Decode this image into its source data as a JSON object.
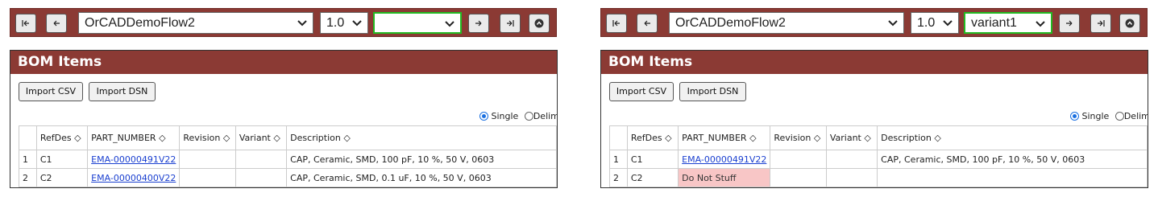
{
  "panels": [
    {
      "toolbar": {
        "design": "OrCADDemoFlow2",
        "version": "1.0",
        "variant": ""
      },
      "bom": {
        "title": "BOM Items",
        "import_csv": "Import CSV",
        "import_dsn": "Import DSN",
        "radio_single": "Single",
        "radio_delim": "Delim",
        "columns": [
          "",
          "RefDes ◇",
          "PART_NUMBER ◇",
          "Revision ◇",
          "Variant ◇",
          "Description ◇"
        ],
        "rows": [
          {
            "n": "1",
            "refdes": "C1",
            "part": "EMA-00000491V22",
            "revision": "",
            "variant": "",
            "desc": "CAP, Ceramic, SMD, 100 pF, 10 %, 50 V, 0603"
          },
          {
            "n": "2",
            "refdes": "C2",
            "part": "EMA-00000400V22",
            "revision": "",
            "variant": "",
            "desc": "CAP, Ceramic, SMD, 0.1 uF, 10 %, 50 V, 0603"
          }
        ]
      }
    },
    {
      "toolbar": {
        "design": "OrCADDemoFlow2",
        "version": "1.0",
        "variant": "variant1"
      },
      "bom": {
        "title": "BOM Items",
        "import_csv": "Import CSV",
        "import_dsn": "Import DSN",
        "radio_single": "Single",
        "radio_delim": "Delim",
        "columns": [
          "",
          "RefDes ◇",
          "PART_NUMBER ◇",
          "Revision ◇",
          "Variant ◇",
          "Description ◇"
        ],
        "rows": [
          {
            "n": "1",
            "refdes": "C1",
            "part": "EMA-00000491V22",
            "revision": "",
            "variant": "",
            "desc": "CAP, Ceramic, SMD, 100 pF, 10 %, 50 V, 0603"
          },
          {
            "n": "2",
            "refdes": "C2",
            "part": "Do Not Stuff",
            "revision": "",
            "variant": "",
            "desc": ""
          }
        ]
      }
    }
  ],
  "colors": {
    "brand": "#8b3a34",
    "variant_border": "#22bb22",
    "dns_fill": "#f8c6c6",
    "link": "#1a3fd0"
  }
}
